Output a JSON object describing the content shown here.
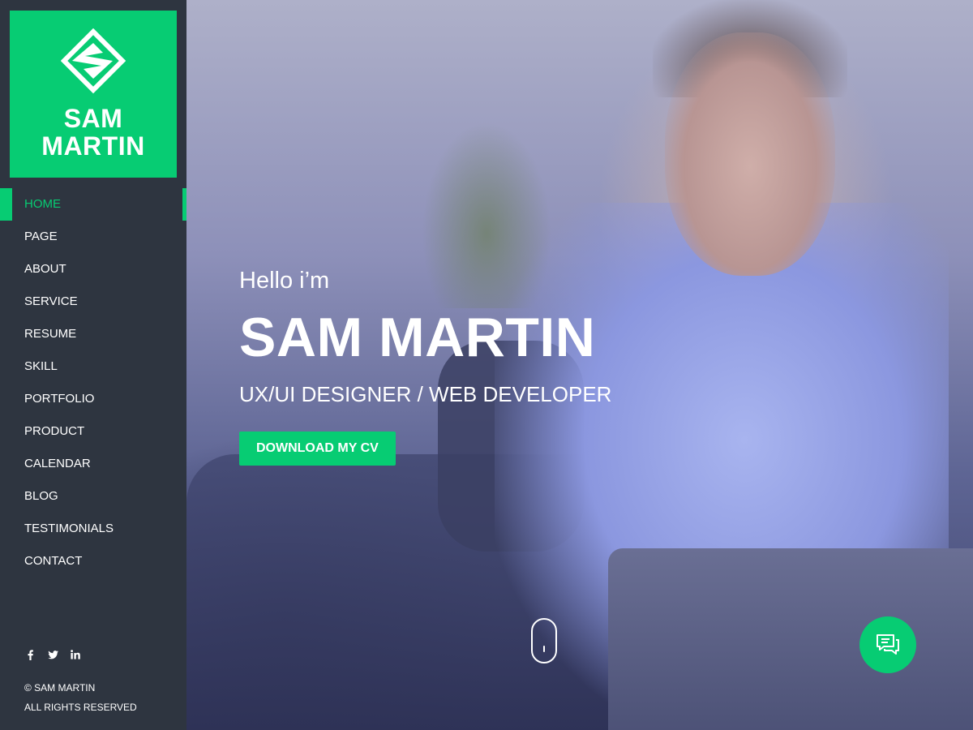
{
  "brand": {
    "name_line1": "SAM",
    "name_line2": "MARTIN",
    "logo_icon": "diamond-s-logo-icon",
    "accent_color": "#07cc73"
  },
  "nav": {
    "items": [
      {
        "label": "HOME",
        "active": true
      },
      {
        "label": "PAGE"
      },
      {
        "label": "ABOUT"
      },
      {
        "label": "SERVICE"
      },
      {
        "label": "RESUME"
      },
      {
        "label": "SKILL"
      },
      {
        "label": "PORTFOLIO"
      },
      {
        "label": "PRODUCT"
      },
      {
        "label": "CALENDAR"
      },
      {
        "label": "BLOG"
      },
      {
        "label": "TESTIMONIALS"
      },
      {
        "label": "CONTACT"
      }
    ]
  },
  "social": {
    "icons": [
      "facebook-icon",
      "twitter-icon",
      "linkedin-icon"
    ]
  },
  "footer": {
    "copyright": "© SAM MARTIN",
    "rights": "ALL RIGHTS RESERVED"
  },
  "hero": {
    "greeting": "Hello i’m",
    "name": "SAM MARTIN",
    "role": "UX/UI DESIGNER / WEB DEVELOPER",
    "cta_label": "DOWNLOAD MY CV",
    "scroll_icon": "mouse-scroll-icon"
  },
  "chat": {
    "icon": "chat-bubbles-icon"
  }
}
